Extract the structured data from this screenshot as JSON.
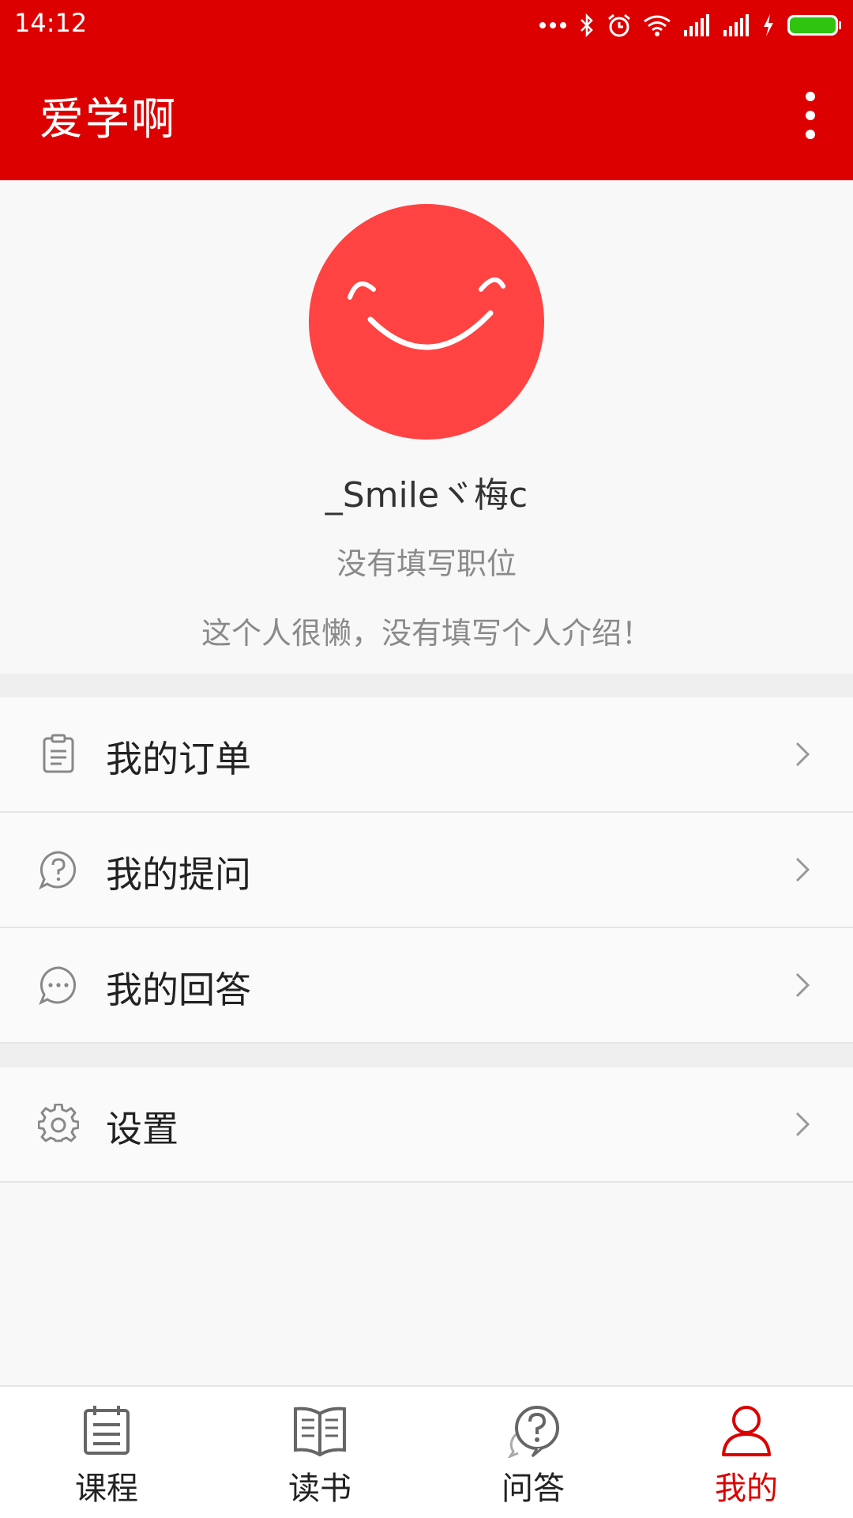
{
  "status_bar": {
    "time": "14:12",
    "icons": [
      "more-dots-icon",
      "bluetooth-icon",
      "alarm-icon",
      "wifi-icon",
      "signal-icon",
      "signal-icon",
      "charging-icon",
      "battery-icon"
    ]
  },
  "app_bar": {
    "title": "爱学啊",
    "menu_icon": "overflow-menu-icon"
  },
  "profile": {
    "avatar_icon": "smile-avatar-icon",
    "username": "_Smileヾ梅c",
    "job": "没有填写职位",
    "intro": "这个人很懒，没有填写个人介绍！"
  },
  "menu": {
    "items": [
      {
        "label": "我的订单",
        "icon": "clipboard-icon"
      },
      {
        "label": "我的提问",
        "icon": "question-bubble-icon"
      },
      {
        "label": "我的回答",
        "icon": "chat-bubble-icon"
      },
      {
        "label": "设置",
        "icon": "gear-icon"
      }
    ]
  },
  "tabs": {
    "items": [
      {
        "label": "课程",
        "icon": "calendar-list-icon",
        "active": false
      },
      {
        "label": "读书",
        "icon": "book-icon",
        "active": false
      },
      {
        "label": "问答",
        "icon": "qa-bubble-icon",
        "active": false
      },
      {
        "label": "我的",
        "icon": "person-icon",
        "active": true
      }
    ]
  },
  "colors": {
    "primary": "#dc0000",
    "avatar_bg": "#ff4343",
    "active_tab": "#dc0000",
    "text_primary": "#222222",
    "text_secondary": "#8a8a8a"
  }
}
